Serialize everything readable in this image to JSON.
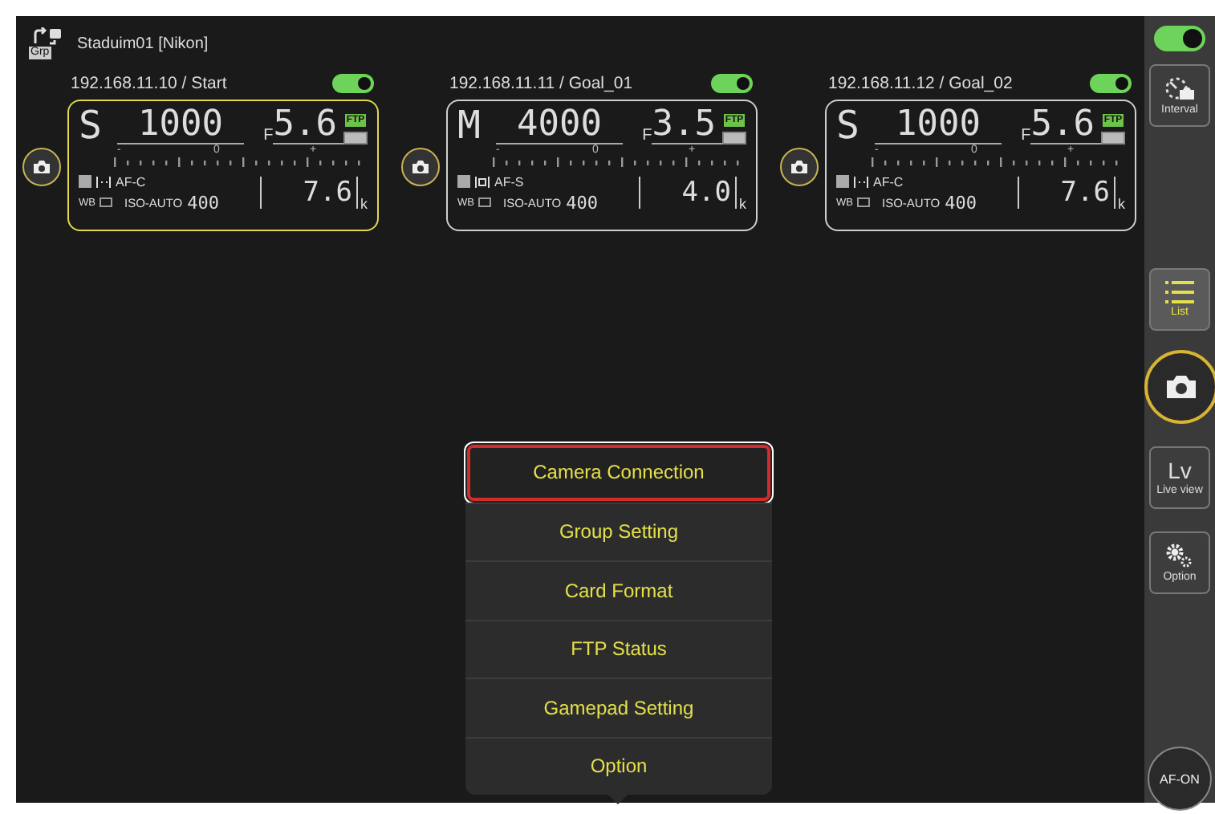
{
  "header": {
    "title": "Staduim01 [Nikon]",
    "badge": "Grp"
  },
  "cameras": [
    {
      "label": "192.168.11.10 / Start",
      "on": true,
      "selected": true,
      "mode": "S",
      "shutter": "1000",
      "f_mark": "F",
      "aperture": "5.6",
      "ftp": "FTP",
      "scale": [
        "-",
        "0",
        "+"
      ],
      "single_point_af": false,
      "af_mode": "AF-C",
      "wb": "WB",
      "iso_label": "ISO-AUTO",
      "iso": "400",
      "buffer": "7.6",
      "buffer_unit": "k"
    },
    {
      "label": "192.168.11.11 / Goal_01",
      "on": true,
      "selected": false,
      "mode": "M",
      "shutter": "4000",
      "f_mark": "F",
      "aperture": "3.5",
      "ftp": "FTP",
      "scale": [
        "-",
        "0",
        "+"
      ],
      "single_point_af": true,
      "af_mode": "AF-S",
      "wb": "WB",
      "iso_label": "ISO-AUTO",
      "iso": "400",
      "buffer": "4.0",
      "buffer_unit": "k"
    },
    {
      "label": "192.168.11.12 / Goal_02",
      "on": true,
      "selected": false,
      "mode": "S",
      "shutter": "1000",
      "f_mark": "F",
      "aperture": "5.6",
      "ftp": "FTP",
      "scale": [
        "-",
        "0",
        "+"
      ],
      "single_point_af": false,
      "af_mode": "AF-C",
      "wb": "WB",
      "iso_label": "ISO-AUTO",
      "iso": "400",
      "buffer": "7.6",
      "buffer_unit": "k"
    }
  ],
  "menu": [
    {
      "label": "Camera Connection",
      "selected": true
    },
    {
      "label": "Group Setting",
      "selected": false
    },
    {
      "label": "Card Format",
      "selected": false
    },
    {
      "label": "FTP Status",
      "selected": false
    },
    {
      "label": "Gamepad Setting",
      "selected": false
    },
    {
      "label": "Option",
      "selected": false
    }
  ],
  "sidebar": {
    "toggle_on": true,
    "buttons": [
      {
        "kind": "interval",
        "label": "Interval",
        "selected": false
      },
      {
        "kind": "list",
        "label": "List",
        "selected": true
      },
      {
        "kind": "shutter",
        "selected": false
      },
      {
        "kind": "lv",
        "big": "Lv",
        "label": "Live view",
        "selected": false
      },
      {
        "kind": "option",
        "label": "Option",
        "selected": false
      },
      {
        "kind": "afon",
        "label": "AF-ON",
        "selected": false
      }
    ]
  }
}
